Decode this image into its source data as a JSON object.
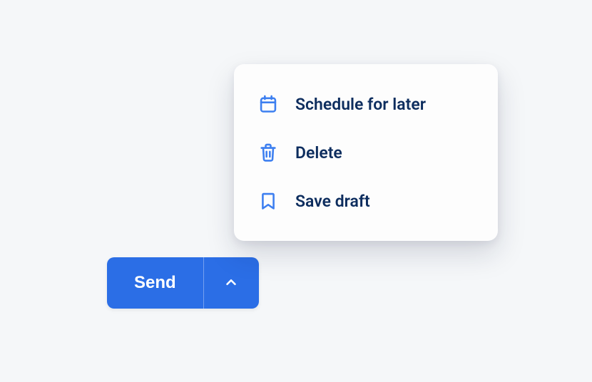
{
  "button": {
    "send_label": "Send"
  },
  "menu": {
    "items": [
      {
        "label": "Schedule for later",
        "icon": "calendar-icon"
      },
      {
        "label": "Delete",
        "icon": "trash-icon"
      },
      {
        "label": "Save draft",
        "icon": "bookmark-icon"
      }
    ]
  },
  "colors": {
    "primary": "#2b6ee6",
    "icon": "#3d7ff0",
    "text": "#0d2d5e",
    "background": "#f5f7f9",
    "popup_bg": "#fdfdfd"
  }
}
